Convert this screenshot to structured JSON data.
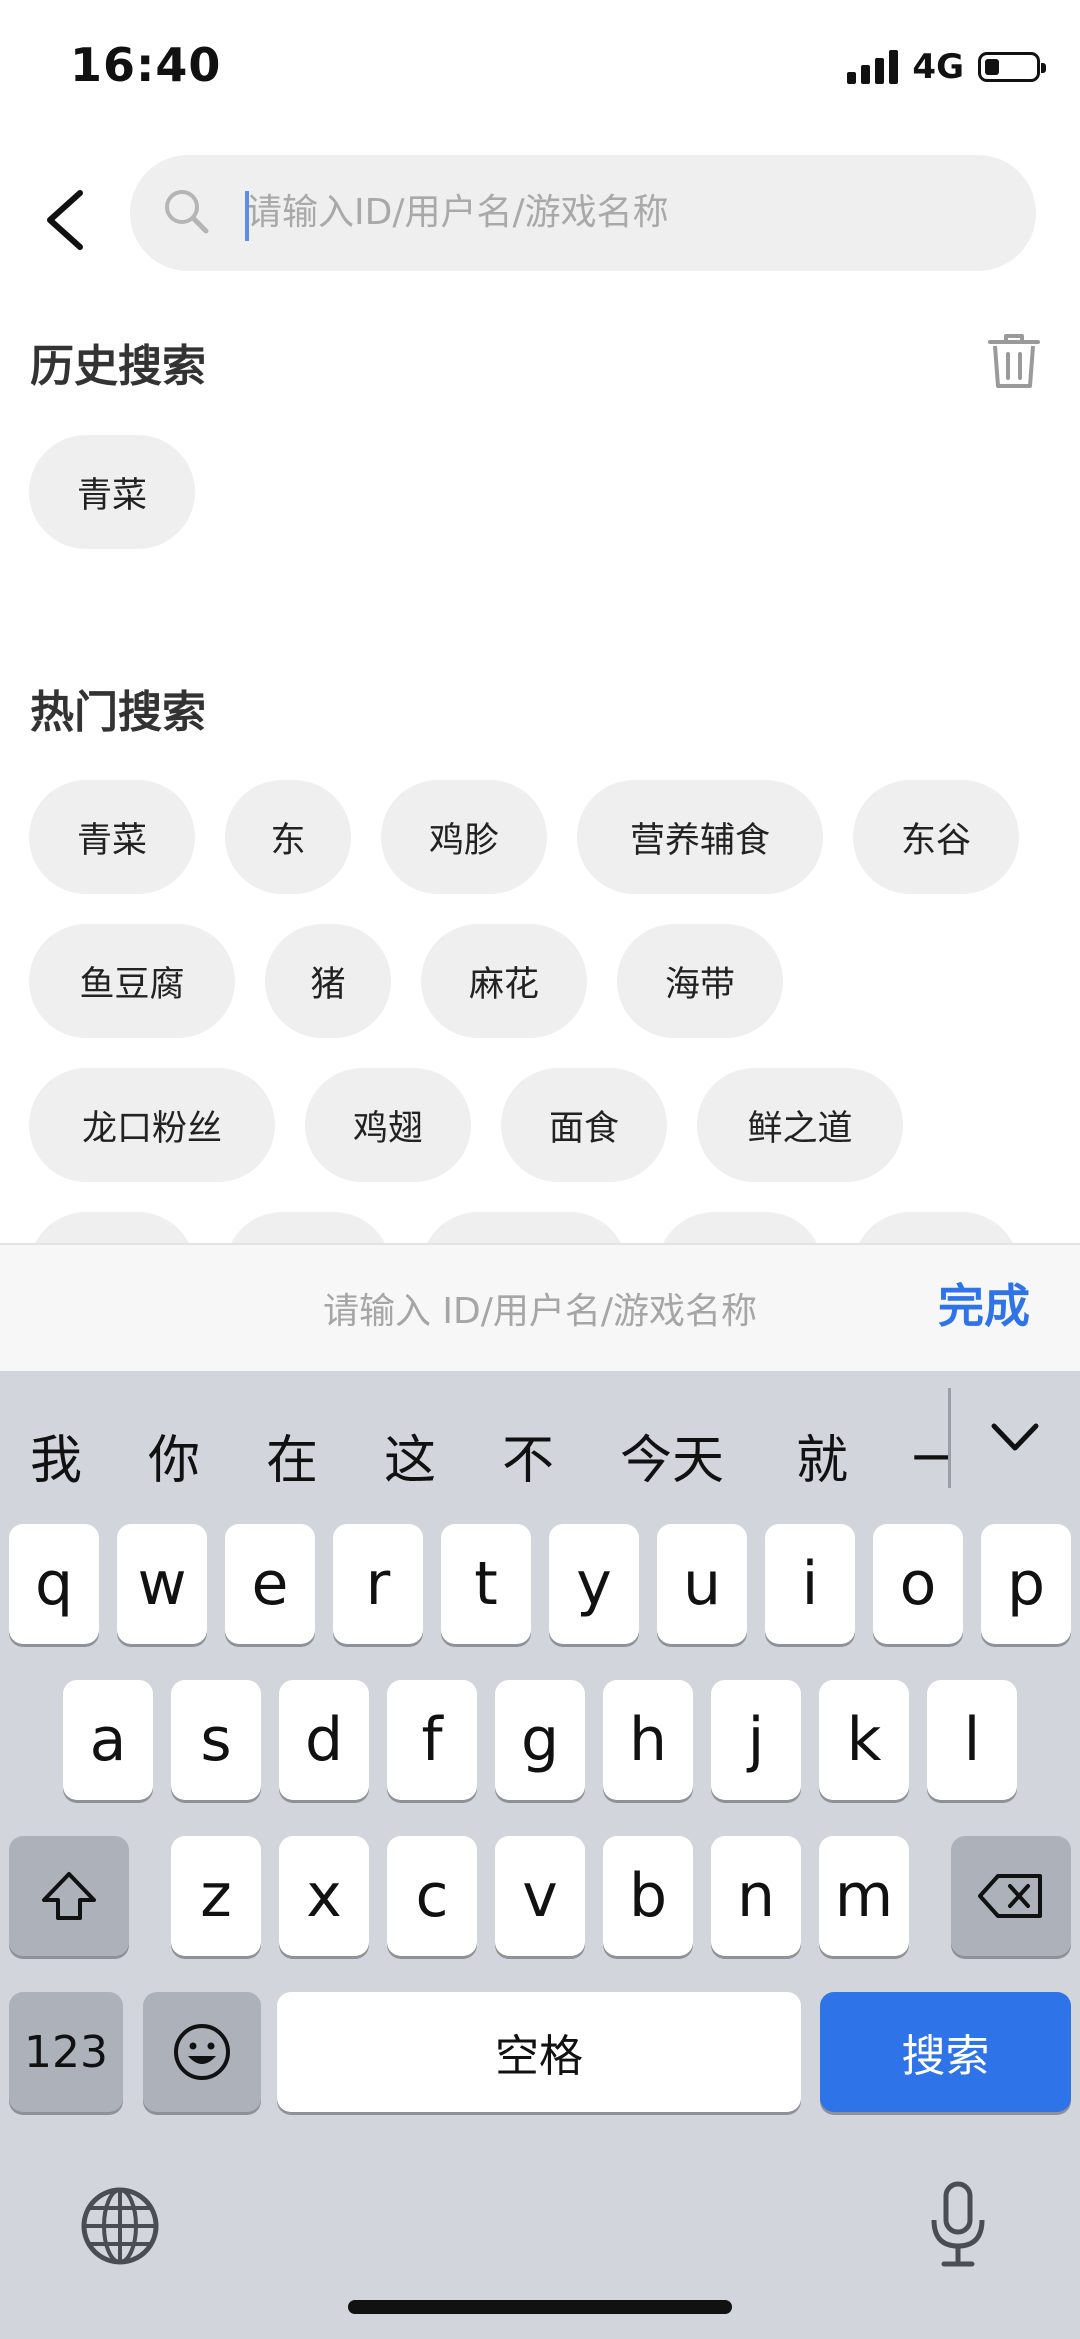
{
  "status_bar": {
    "time": "16:40",
    "network": "4G"
  },
  "search": {
    "placeholder": "请输入ID/用户名/游戏名称"
  },
  "history": {
    "title": "历史搜索",
    "items": [
      "青菜"
    ]
  },
  "hot": {
    "title": "热门搜索",
    "rows": [
      [
        "青菜",
        "东",
        "鸡胗",
        "营养辅食",
        "东谷"
      ],
      [
        "鱼豆腐",
        "猪",
        "麻花",
        "海带"
      ],
      [
        "龙口粉丝",
        "鸡翅",
        "面食",
        "鲜之道"
      ]
    ]
  },
  "accessory": {
    "placeholder": "请输入 ID/用户名/游戏名称",
    "done_label": "完成"
  },
  "keyboard": {
    "candidates": [
      "我",
      "你",
      "在",
      "这",
      "不",
      "今天",
      "就",
      "一"
    ],
    "row1": [
      "q",
      "w",
      "e",
      "r",
      "t",
      "y",
      "u",
      "i",
      "o",
      "p"
    ],
    "row2": [
      "a",
      "s",
      "d",
      "f",
      "g",
      "h",
      "j",
      "k",
      "l"
    ],
    "row3": [
      "z",
      "x",
      "c",
      "v",
      "b",
      "n",
      "m"
    ],
    "numbers_label": "123",
    "space_label": "空格",
    "search_label": "搜索"
  },
  "colors": {
    "accent": "#2f73e8",
    "chip": "#efefef",
    "keyboard_bg": "#d2d5db"
  }
}
